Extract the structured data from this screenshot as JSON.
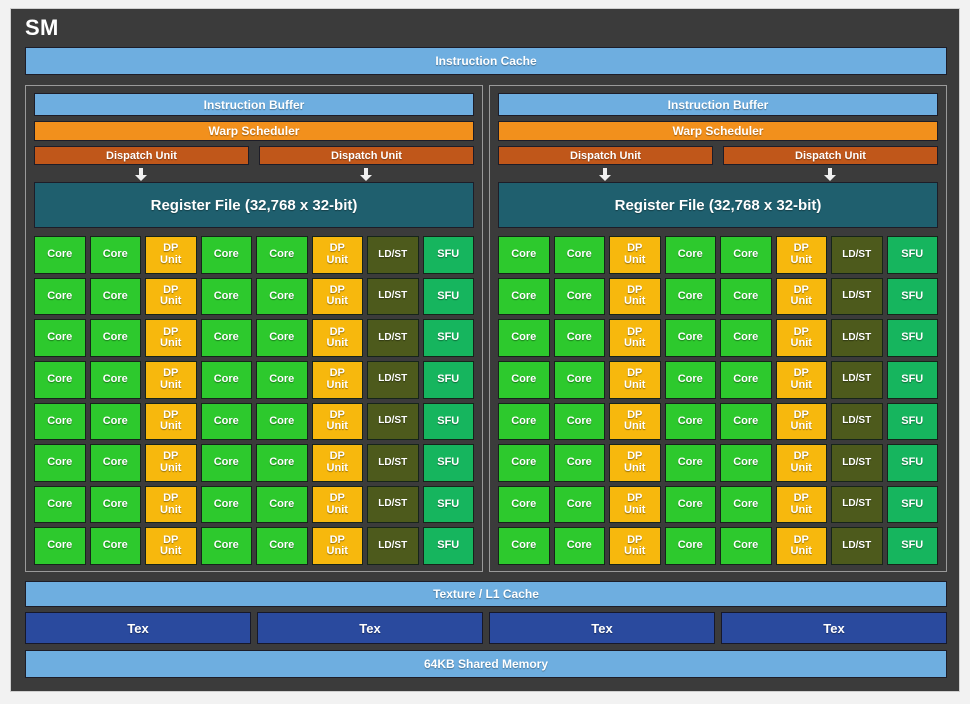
{
  "diagram": {
    "title": "SM",
    "instruction_cache": "Instruction Cache",
    "texture_l1_cache": "Texture / L1 Cache",
    "shared_memory": "64KB Shared Memory",
    "tex_units": [
      {
        "label": "Tex"
      },
      {
        "label": "Tex"
      },
      {
        "label": "Tex"
      },
      {
        "label": "Tex"
      }
    ],
    "processing_blocks": [
      {
        "name": "left",
        "instruction_buffer": "Instruction Buffer",
        "warp_scheduler": "Warp Scheduler",
        "dispatch_units": [
          "Dispatch Unit",
          "Dispatch Unit"
        ],
        "register_file": "Register File (32,768 x 32-bit)"
      },
      {
        "name": "right",
        "instruction_buffer": "Instruction Buffer",
        "warp_scheduler": "Warp Scheduler",
        "dispatch_units": [
          "Dispatch Unit",
          "Dispatch Unit"
        ],
        "register_file": "Register File (32,768 x 32-bit)"
      }
    ],
    "unit_grid": {
      "rows": 8,
      "columns": 8,
      "column_pattern": [
        {
          "type": "core",
          "label": "Core"
        },
        {
          "type": "core",
          "label": "Core"
        },
        {
          "type": "dp",
          "label_line1": "DP",
          "label_line2": "Unit"
        },
        {
          "type": "core",
          "label": "Core"
        },
        {
          "type": "core",
          "label": "Core"
        },
        {
          "type": "dp",
          "label_line1": "DP",
          "label_line2": "Unit"
        },
        {
          "type": "ldst",
          "label": "LD/ST"
        },
        {
          "type": "sfu",
          "label": "SFU"
        }
      ]
    },
    "colors": {
      "panel_background": "#3b3b3b",
      "page_background": "#f2f2f2",
      "cache_blue": "#6eaee0",
      "warp_orange": "#f2901c",
      "dispatch_orange": "#c0571a",
      "register_teal": "#1f5f6e",
      "core_green": "#2dc92d",
      "dp_amber": "#f7b80d",
      "ldst_olive": "#4d5a1c",
      "sfu_green": "#16b55e",
      "tex_blue": "#2a4a9e",
      "text_white": "#ffffff"
    }
  }
}
